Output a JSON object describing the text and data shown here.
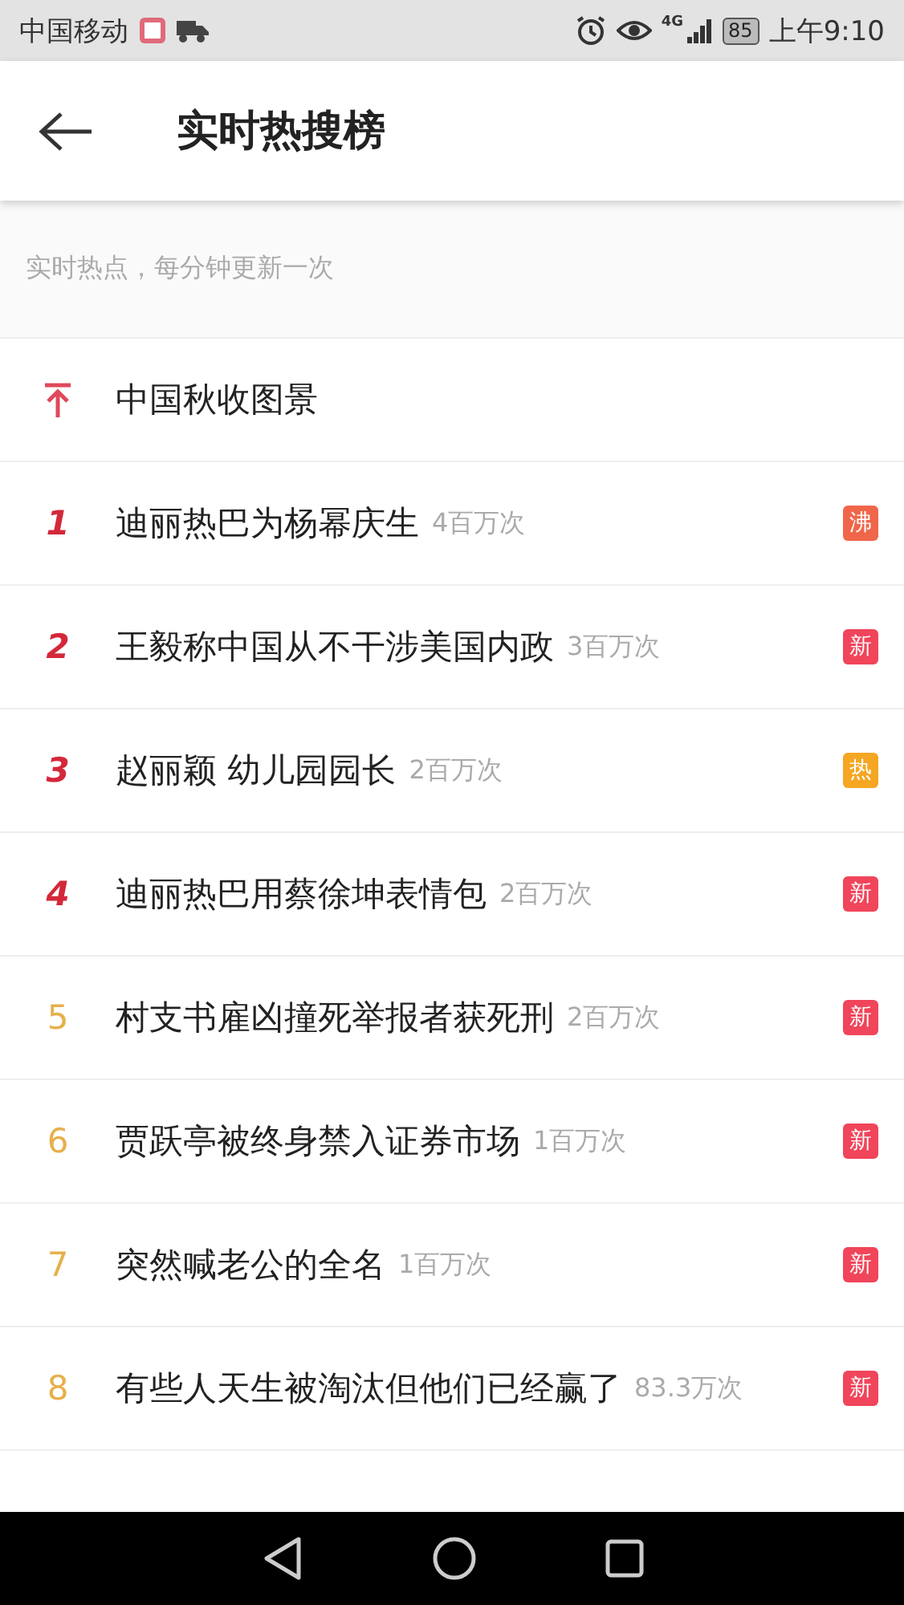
{
  "status_bar": {
    "carrier": "中国移动",
    "network": "4G",
    "battery": "85",
    "time": "上午9:10"
  },
  "header": {
    "title": "实时热搜榜"
  },
  "subtitle": "实时热点，每分钟更新一次",
  "items": [
    {
      "kind": "pinned",
      "title": "中国秋收图景"
    },
    {
      "kind": "major",
      "rank": "1",
      "title": "迪丽热巴为杨幂庆生",
      "count": "4百万次",
      "badge": "沸",
      "color": "#f0664a"
    },
    {
      "kind": "major",
      "rank": "2",
      "title": "王毅称中国从不干涉美国内政",
      "count": "3百万次",
      "badge": "新",
      "color": "#f0455a"
    },
    {
      "kind": "major",
      "rank": "3",
      "title": "赵丽颖 幼儿园园长",
      "count": "2百万次",
      "badge": "热",
      "color": "#f5a623"
    },
    {
      "kind": "major",
      "rank": "4",
      "title": "迪丽热巴用蔡徐坤表情包",
      "count": "2百万次",
      "badge": "新",
      "color": "#f0455a"
    },
    {
      "kind": "minor",
      "rank": "5",
      "title": "村支书雇凶撞死举报者获死刑",
      "count": "2百万次",
      "badge": "新",
      "color": "#f0455a"
    },
    {
      "kind": "minor",
      "rank": "6",
      "title": "贾跃亭被终身禁入证券市场",
      "count": "1百万次",
      "badge": "新",
      "color": "#f0455a"
    },
    {
      "kind": "minor",
      "rank": "7",
      "title": "突然喊老公的全名",
      "count": "1百万次",
      "badge": "新",
      "color": "#f0455a"
    },
    {
      "kind": "minor",
      "rank": "8",
      "title": "有些人天生被淘汰但他们已经赢了",
      "count": "83.3万次",
      "badge": "新",
      "color": "#f0455a"
    }
  ]
}
